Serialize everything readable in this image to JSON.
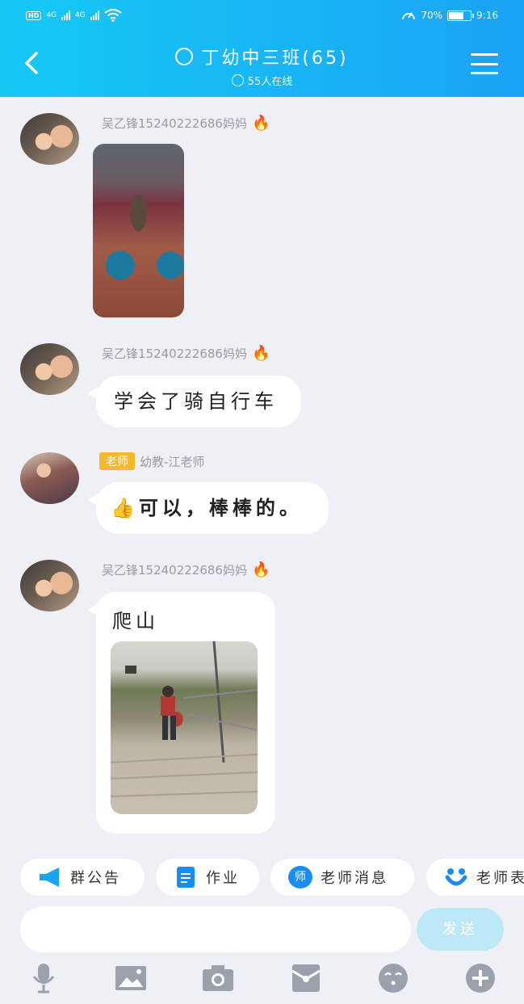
{
  "status_bar": {
    "left_badge": "HD",
    "network1": "4G",
    "network2": "4G",
    "battery_percent": "70%",
    "battery_level": 0.7,
    "time": "9:16"
  },
  "header": {
    "title": "丁幼中三班(65)",
    "online_text": "55人在线"
  },
  "messages": [
    {
      "sender": "吴乙锋15240222686妈妈",
      "type": "image"
    },
    {
      "sender": "吴乙锋15240222686妈妈",
      "text": "学会了骑自行车"
    },
    {
      "sender": "幼教-江老师",
      "tag": "老师",
      "emoji": "👍",
      "text": "可以，棒棒的。"
    },
    {
      "sender": "吴乙锋15240222686妈妈",
      "text": "爬山",
      "has_image": true
    }
  ],
  "fire_emoji": "🔥",
  "chips": [
    {
      "label": "群公告",
      "icon": "megaphone-icon",
      "color": "#1aa3f5"
    },
    {
      "label": "作业",
      "icon": "document-icon",
      "color": "#1a8cf5"
    },
    {
      "label": "老师消息",
      "icon": "teacher-chat-icon",
      "icon_text": "师",
      "color": "#1a8cf5"
    },
    {
      "label": "老师表",
      "icon": "smile-icon",
      "color": "#1a8cf5"
    }
  ],
  "input": {
    "placeholder": ""
  },
  "send_label": "发送",
  "toolbar": [
    "microphone-icon",
    "image-icon",
    "camera-icon",
    "red-packet-icon",
    "emoji-icon",
    "plus-icon"
  ],
  "colors": {
    "header_start": "#16c9f5",
    "header_end": "#1aa3f5",
    "toolbar_icon": "#9aa0ac",
    "tag": "#f6b92c"
  }
}
